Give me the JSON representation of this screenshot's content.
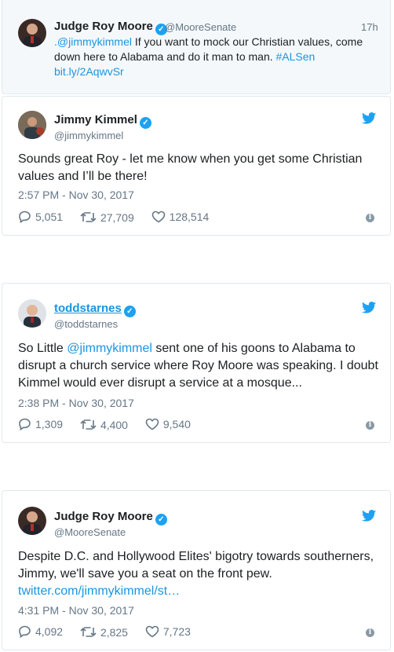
{
  "quoted": {
    "name": "Judge Roy Moore",
    "handle": "@MooreSenate",
    "age": "17h",
    "text_mention": ".@jimmykimmel",
    "text_body": " If you want to mock our Christian values, come down here to Alabama and do it man to man. ",
    "hashtag": "#ALSen",
    "link": "bit.ly/2AqwvSr"
  },
  "tweets": [
    {
      "name": "Jimmy Kimmel",
      "handle": "@jimmykimmel",
      "text": "Sounds great Roy - let me know when you get some Christian values and I’ll be there!",
      "timestamp": "2:57 PM - Nov 30, 2017",
      "replies": "5,051",
      "retweets": "27,709",
      "likes": "128,514"
    },
    {
      "name": "toddstarnes",
      "handle": "@toddstarnes",
      "text_pre": "So Little ",
      "text_mention": "@jimmykimmel",
      "text_post": " sent one of his goons to Alabama to disrupt a church service where Roy Moore was speaking. I doubt Kimmel would ever disrupt a service at a mosque...",
      "timestamp": "2:38 PM - Nov 30, 2017",
      "replies": "1,309",
      "retweets": "4,400",
      "likes": "9,540"
    },
    {
      "name": "Judge Roy Moore",
      "handle": "@MooreSenate",
      "text": "Despite D.C. and Hollywood Elites' bigotry towards southerners, Jimmy, we'll save you a seat on the front pew.",
      "link": "twitter.com/jimmykimmel/st…",
      "timestamp": "4:31 PM - Nov 30, 2017",
      "replies": "4,092",
      "retweets": "2,825",
      "likes": "7,723"
    }
  ],
  "icons": {
    "verified": "verified-check",
    "twitter": "twitter-bird",
    "reply": "reply-bubble",
    "retweet": "retweet-arrows",
    "like": "heart",
    "info": "info-circle"
  },
  "colors": {
    "accent": "#1da1f2",
    "link": "#1b95e0",
    "muted": "#657786",
    "border": "#e1e8ed"
  }
}
